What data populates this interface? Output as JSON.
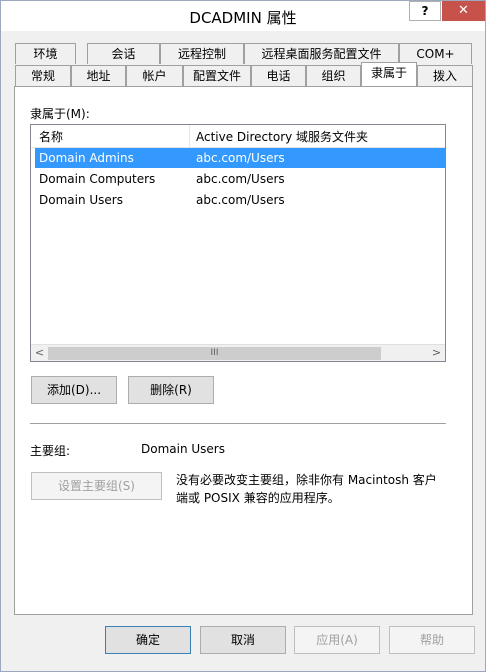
{
  "window": {
    "title": "DCADMIN 属性",
    "help_label": "?",
    "close_label": "✕"
  },
  "tabs_row1": [
    "环境",
    "会话",
    "远程控制",
    "远程桌面服务配置文件",
    "COM+"
  ],
  "tabs_row2": [
    "常规",
    "地址",
    "帐户",
    "配置文件",
    "电话",
    "组织",
    "隶属于",
    "拨入"
  ],
  "active_tab": "隶属于",
  "member_of": {
    "label": "隶属于(M):",
    "columns": [
      "名称",
      "Active Directory 域服务文件夹"
    ],
    "rows": [
      {
        "name": "Domain Admins",
        "folder": "abc.com/Users",
        "selected": true
      },
      {
        "name": "Domain Computers",
        "folder": "abc.com/Users",
        "selected": false
      },
      {
        "name": "Domain Users",
        "folder": "abc.com/Users",
        "selected": false
      }
    ],
    "scroll_left": "<",
    "scroll_right": ">",
    "scroll_grip": "III"
  },
  "buttons": {
    "add": "添加(D)...",
    "remove": "删除(R)"
  },
  "primary_group": {
    "label": "主要组:",
    "value": "Domain Users",
    "set_button": "设置主要组(S)",
    "description": "没有必要改变主要组，除非你有 Macintosh 客户端或 POSIX 兼容的应用程序。"
  },
  "footer": {
    "ok": "确定",
    "cancel": "取消",
    "apply": "应用(A)",
    "help": "帮助"
  },
  "colors": {
    "selection": "#3399ff",
    "close": "#c7514b"
  }
}
